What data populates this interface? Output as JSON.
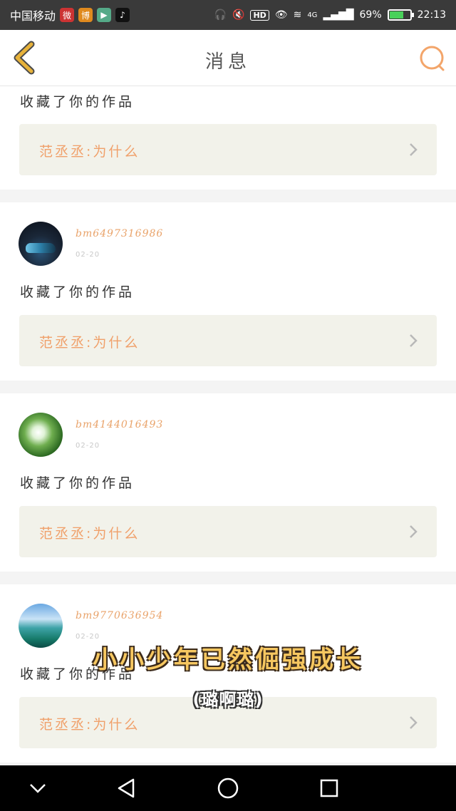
{
  "status_bar": {
    "carrier": "中国移动",
    "battery_percent": "69%",
    "battery_level": 0.69,
    "network": "4G",
    "hd_label": "HD",
    "time": "22:13"
  },
  "header": {
    "title": "消息"
  },
  "notifications": [
    {
      "username": "",
      "date": "",
      "action": "收藏了你的作品",
      "work_title": "范丞丞:为什么"
    },
    {
      "username": "bm6497316986",
      "date": "02-20",
      "action": "收藏了你的作品",
      "work_title": "范丞丞:为什么"
    },
    {
      "username": "bm4144016493",
      "date": "02-20",
      "action": "收藏了你的作品",
      "work_title": "范丞丞:为什么"
    },
    {
      "username": "bm9770636954",
      "date": "02-20",
      "action": "收藏了你的作品",
      "work_title": "范丞丞:为什么"
    }
  ],
  "overlay": {
    "subtitle_main": "小小少年已然倔强成长",
    "subtitle_sub": "(璐啊璐)"
  },
  "colors": {
    "accent": "#f0a06a",
    "back_icon": "#e7b23a",
    "search_icon": "#f3a56a"
  }
}
